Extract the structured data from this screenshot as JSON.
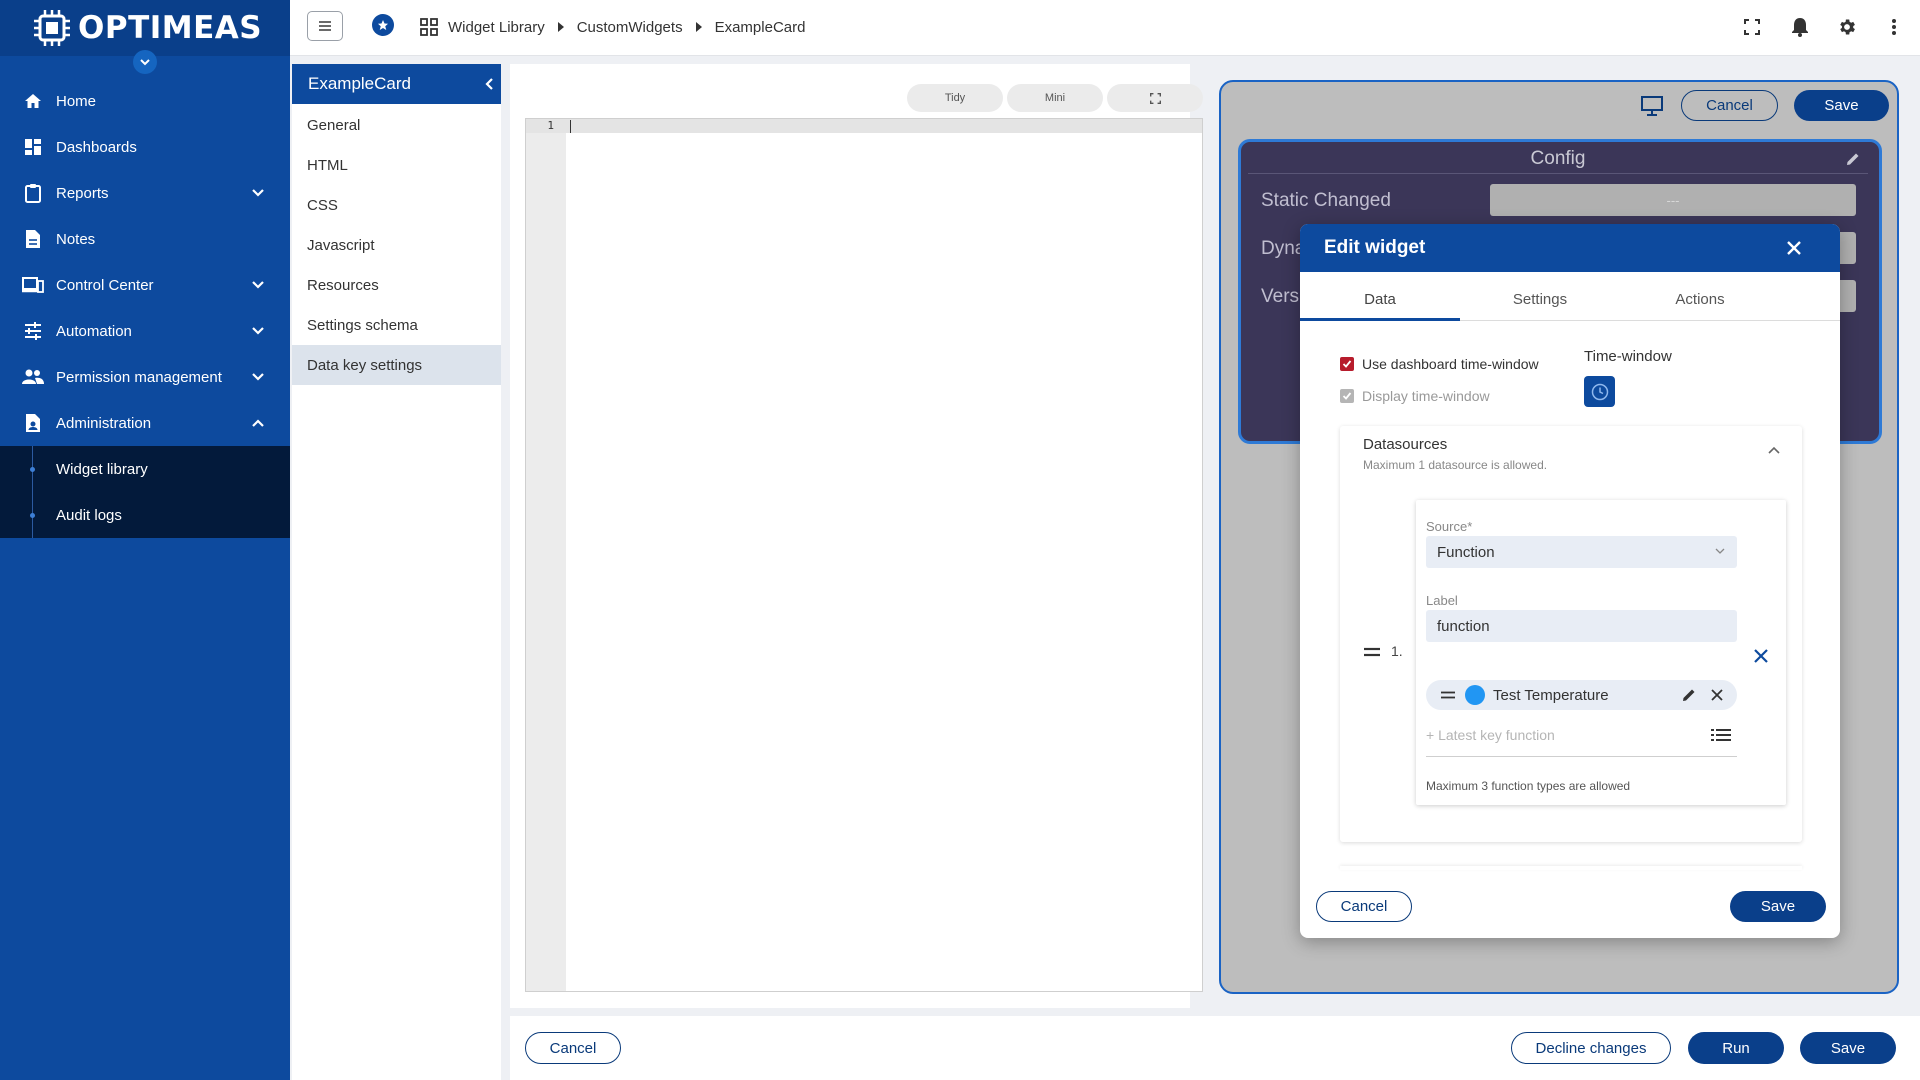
{
  "brand": {
    "logo_text": "OPTIMEAS"
  },
  "sidebar": {
    "items": [
      {
        "label": "Home",
        "icon": "home-icon"
      },
      {
        "label": "Dashboards",
        "icon": "dashboard-icon"
      },
      {
        "label": "Reports",
        "icon": "clipboard-icon",
        "expandable": true
      },
      {
        "label": "Notes",
        "icon": "note-icon"
      },
      {
        "label": "Control Center",
        "icon": "devices-icon",
        "expandable": true
      },
      {
        "label": "Automation",
        "icon": "tune-icon",
        "expandable": true
      },
      {
        "label": "Permission management",
        "icon": "people-icon",
        "expandable": true
      },
      {
        "label": "Administration",
        "icon": "admin-doc-icon",
        "expanded": true
      }
    ],
    "subitems": [
      {
        "label": "Widget library"
      },
      {
        "label": "Audit logs"
      }
    ]
  },
  "breadcrumb": {
    "items": [
      "Widget Library",
      "CustomWidgets",
      "ExampleCard"
    ]
  },
  "left_panel": {
    "title": "ExampleCard",
    "items": [
      "General",
      "HTML",
      "CSS",
      "Javascript",
      "Resources",
      "Settings schema",
      "Data key settings"
    ],
    "active_index": 6
  },
  "editor": {
    "buttons": {
      "tidy": "Tidy",
      "mini": "Mini"
    },
    "line_number": "1"
  },
  "preview": {
    "cancel_label": "Cancel",
    "save_label": "Save",
    "config": {
      "title": "Config",
      "rows": [
        {
          "label": "Static Changed",
          "value": "---"
        },
        {
          "label": "Dyna"
        },
        {
          "label": "Vers"
        }
      ]
    }
  },
  "dialog": {
    "title": "Edit widget",
    "tabs": [
      "Data",
      "Settings",
      "Actions"
    ],
    "active_tab": 0,
    "use_dashboard_tw": {
      "label": "Use dashboard time-window",
      "checked": true
    },
    "display_tw": {
      "label": "Display time-window",
      "checked": true,
      "disabled": true
    },
    "time_window_label": "Time-window",
    "datasources": {
      "title": "Datasources",
      "subtitle": "Maximum 1 datasource is allowed.",
      "index_label": "1.",
      "source_label": "Source*",
      "source_value": "Function",
      "label_label": "Label",
      "label_value": "function",
      "key_name": "Test Temperature",
      "key_color": "#2196f3",
      "latest_placeholder": "+ Latest key function",
      "max_note": "Maximum 3 function types are allowed"
    },
    "cancel_label": "Cancel",
    "save_label": "Save"
  },
  "bottom_bar": {
    "cancel_label": "Cancel",
    "decline_label": "Decline changes",
    "run_label": "Run",
    "save_label": "Save"
  },
  "colors": {
    "sidebar": "#0d4a9e",
    "sidebar_dark": "#031a3b",
    "accent": "#0a3f8a",
    "checkbox_red": "#b71c2c"
  }
}
